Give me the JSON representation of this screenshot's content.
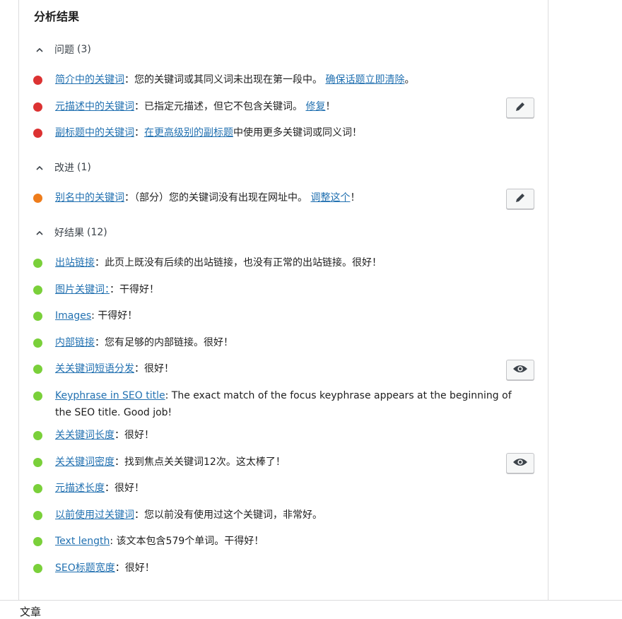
{
  "panel": {
    "title": "分析结果"
  },
  "sections": {
    "problems": {
      "label": "问题",
      "count": "(3)"
    },
    "improvements": {
      "label": "改进",
      "count": "(1)"
    },
    "good": {
      "label": "好结果",
      "count": "(12)"
    }
  },
  "problems": [
    {
      "link": "简介中的关键词",
      "text": "：您的关键词或其同义词未出现在第一段中。 ",
      "link2": "确保话题立即清除",
      "tail": "。",
      "status": "red"
    },
    {
      "link": "元描述中的关键词",
      "text": "：已指定元描述，但它不包含关键词。 ",
      "link2": "修复",
      "tail": "！",
      "status": "red",
      "action_icon": "pencil-icon"
    },
    {
      "link": "副标题中的关键词",
      "text": "：",
      "link2": "在更高级别的副标题",
      "tail": "中使用更多关键词或同义词！",
      "status": "red"
    }
  ],
  "improvements": [
    {
      "link": "别名中的关键词",
      "text": "：（部分）您的关键词没有出现在网址中。 ",
      "link2": "调整这个",
      "tail": "！",
      "status": "orange",
      "action_icon": "pencil-icon"
    }
  ],
  "good": [
    {
      "link": "出站链接",
      "text": "：此页上既没有后续的出站链接，也没有正常的出站链接。很好！"
    },
    {
      "link": "图片关键词：",
      "text": "：干得好！"
    },
    {
      "link": "Images",
      "text": ": 干得好！"
    },
    {
      "link": "内部链接",
      "text": "：您有足够的内部链接。很好！"
    },
    {
      "link": "关关键词短语分发",
      "text": "：很好！",
      "action_icon": "eye-icon"
    },
    {
      "link": "Keyphrase in SEO title",
      "text": ": The exact match of the focus keyphrase appears at the beginning of the SEO title. Good job!"
    },
    {
      "link": "关关键词长度",
      "text": "：很好！"
    },
    {
      "link": "关关键词密度",
      "text": "：找到焦点关关键词12次。这太棒了！",
      "action_icon": "eye-icon"
    },
    {
      "link": "元描述长度",
      "text": "：很好！"
    },
    {
      "link": "以前使用过关键词",
      "text": "：您以前没有使用过这个关键词，非常好。"
    },
    {
      "link": "Text length",
      "text": ": 该文本包含579个单词。干得好！"
    },
    {
      "link": "SEO标题宽度",
      "text": "：很好！"
    }
  ],
  "colors": {
    "problem": "#dc3232",
    "improvement": "#ee7c1b",
    "good": "#7ad03a",
    "link": "#2271b1"
  },
  "footer": {
    "label": "文章"
  }
}
